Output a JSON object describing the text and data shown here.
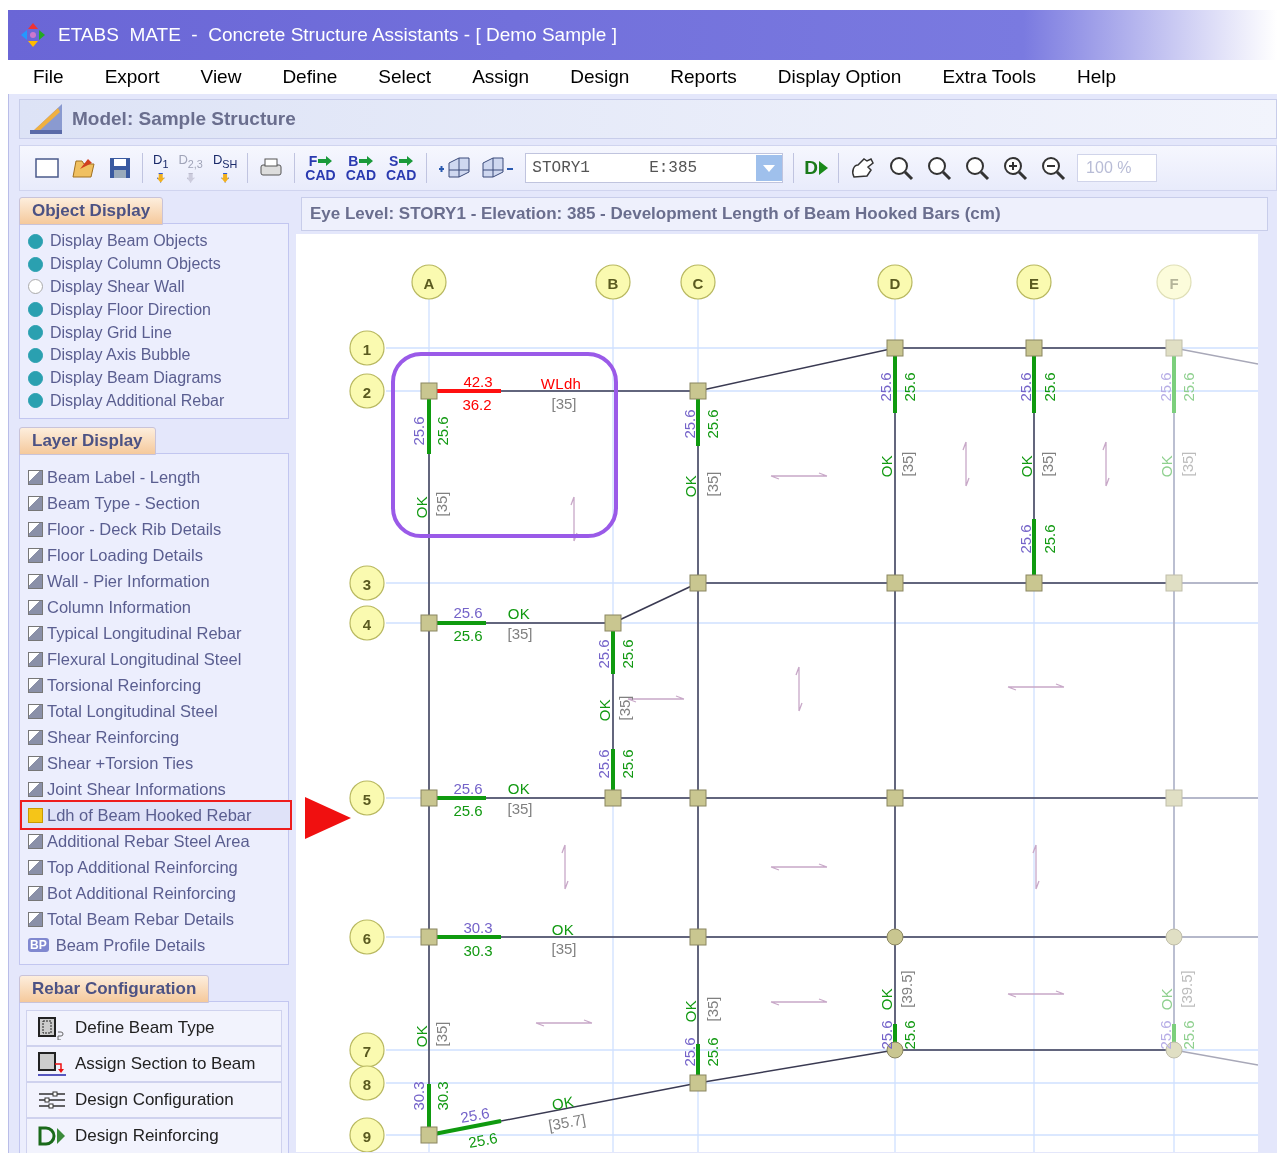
{
  "window": {
    "title": "ETABS  MATE  -  Concrete Structure Assistants - [ Demo Sample ]"
  },
  "menu": [
    "File",
    "Export",
    "View",
    "Define",
    "Select",
    "Assign",
    "Design",
    "Reports",
    "Display Option",
    "Extra Tools",
    "Help"
  ],
  "model_header": "Model: Sample Structure",
  "toolbar": {
    "design_keys": [
      {
        "label": "D$_{1}$",
        "disabled": false
      },
      {
        "label": "D$_{2,3}$",
        "disabled": true
      },
      {
        "label": "D$_{SH}$",
        "disabled": false
      }
    ],
    "cad_exports": [
      {
        "letter": "F",
        "label": "CAD"
      },
      {
        "letter": "B",
        "label": "CAD"
      },
      {
        "letter": "S",
        "label": "CAD"
      }
    ],
    "story_select": {
      "story": "STORY1",
      "elevation": "E:385"
    },
    "run_design": "D",
    "zoom_level": {
      "value": "100 %",
      "disabled": true
    }
  },
  "object_display": {
    "title": "Object Display",
    "items": [
      {
        "label": "Display Beam Objects",
        "checked": true
      },
      {
        "label": "Display Column Objects",
        "checked": true
      },
      {
        "label": "Display Shear Wall",
        "checked": false
      },
      {
        "label": "Display Floor Direction",
        "checked": true
      },
      {
        "label": "Display Grid Line",
        "checked": true
      },
      {
        "label": "Display Axis Bubble",
        "checked": true
      },
      {
        "label": "Display Beam Diagrams",
        "checked": true
      },
      {
        "label": "Display Additional Rebar",
        "checked": true
      }
    ]
  },
  "layer_display": {
    "title": "Layer Display",
    "items": [
      {
        "label": "Beam Label - Length",
        "selected": false
      },
      {
        "label": "Beam Type - Section",
        "selected": false
      },
      {
        "label": "Floor - Deck Rib Details",
        "selected": false
      },
      {
        "label": "Floor Loading Details",
        "selected": false
      },
      {
        "label": "Wall - Pier Information",
        "selected": false
      },
      {
        "label": "Column Information",
        "selected": false
      },
      {
        "label": "Typical Longitudinal Rebar",
        "selected": false
      },
      {
        "label": "Flexural Longitudinal Steel",
        "selected": false
      },
      {
        "label": "Torsional Reinforcing",
        "selected": false
      },
      {
        "label": "Total Longitudinal Steel",
        "selected": false
      },
      {
        "label": "Shear Reinforcing",
        "selected": false
      },
      {
        "label": "Shear +Torsion Ties",
        "selected": false
      },
      {
        "label": "Joint Shear Informations",
        "selected": false
      },
      {
        "label": "Ldh of Beam Hooked Rebar",
        "selected": true
      },
      {
        "label": "Additional Rebar Steel Area",
        "selected": false
      },
      {
        "label": "Top Additional Reinforcing",
        "selected": false
      },
      {
        "label": "Bot  Additional Reinforcing",
        "selected": false
      },
      {
        "label": "Total Beam Rebar Details",
        "selected": false
      }
    ],
    "profile": {
      "badge": "BP",
      "label": "Beam Profile Details"
    }
  },
  "rebar_configuration": {
    "title": "Rebar Configuration",
    "buttons": [
      {
        "kind": "define",
        "label": "Define Beam Type"
      },
      {
        "kind": "assign",
        "label": "Assign Section to Beam"
      },
      {
        "kind": "config",
        "label": "Design Configuration"
      },
      {
        "kind": "design",
        "label": "Design Reinforcing"
      }
    ]
  },
  "canvas": {
    "title": "Eye Level: STORY1 - Elevation: 385 - Development Length of Beam Hooked Bars (cm)",
    "column_axes": [
      {
        "label": "A",
        "dimmed": false
      },
      {
        "label": "B",
        "dimmed": false
      },
      {
        "label": "C",
        "dimmed": false
      },
      {
        "label": "D",
        "dimmed": false
      },
      {
        "label": "E",
        "dimmed": false
      },
      {
        "label": "F",
        "dimmed": true
      }
    ],
    "row_axes": [
      "1",
      "2",
      "3",
      "4",
      "5",
      "6",
      "7",
      "8",
      "9"
    ],
    "annotations": [
      {
        "text": "42.3",
        "kind": "value",
        "color": "#ff0000"
      },
      {
        "text": "36.2",
        "kind": "value",
        "color": "#ff0000"
      },
      {
        "text": "WLdh",
        "kind": "status",
        "color": "#ff0000"
      },
      {
        "text": "[35]",
        "kind": "limit",
        "color": "#808080"
      },
      {
        "text": "25.6",
        "kind": "value",
        "color": "#7463c9"
      },
      {
        "text": "25.6",
        "kind": "value",
        "color": "#119911"
      },
      {
        "text": "OK",
        "kind": "status",
        "color": "#119911"
      },
      {
        "text": "[35]",
        "kind": "limit",
        "color": "#808080"
      },
      {
        "text": "25.6",
        "kind": "value",
        "color": "#7463c9"
      },
      {
        "text": "25.6",
        "kind": "value",
        "color": "#119911"
      },
      {
        "text": "OK",
        "kind": "status",
        "color": "#119911"
      },
      {
        "text": "[35]",
        "kind": "limit",
        "color": "#808080"
      },
      {
        "text": "25.6",
        "kind": "value",
        "color": "#7463c9"
      },
      {
        "text": "25.6",
        "kind": "value",
        "color": "#119911"
      },
      {
        "text": "OK",
        "kind": "status",
        "color": "#119911"
      },
      {
        "text": "[35]",
        "kind": "limit",
        "color": "#808080"
      },
      {
        "text": "25.6",
        "kind": "value",
        "color": "#7463c9"
      },
      {
        "text": "25.6",
        "kind": "value",
        "color": "#119911"
      },
      {
        "text": "OK",
        "kind": "status",
        "color": "#119911"
      },
      {
        "text": "[35]",
        "kind": "limit",
        "color": "#808080"
      },
      {
        "text": "25.6",
        "kind": "value",
        "color": "#7463c9"
      },
      {
        "text": "25.6",
        "kind": "value",
        "color": "#119911"
      },
      {
        "text": "25.6",
        "kind": "value",
        "color": "#b7aee6"
      },
      {
        "text": "25.6",
        "kind": "value",
        "color": "#8fd08f"
      },
      {
        "text": "OK",
        "kind": "status",
        "color": "#8fd08f"
      },
      {
        "text": "[35]",
        "kind": "limit",
        "color": "#bcbcbc"
      },
      {
        "text": "25.6",
        "kind": "value",
        "color": "#7463c9"
      },
      {
        "text": "25.6",
        "kind": "value",
        "color": "#119911"
      },
      {
        "text": "OK",
        "kind": "status",
        "color": "#119911"
      },
      {
        "text": "[35]",
        "kind": "limit",
        "color": "#808080"
      },
      {
        "text": "25.6",
        "kind": "value",
        "color": "#7463c9"
      },
      {
        "text": "25.6",
        "kind": "value",
        "color": "#119911"
      },
      {
        "text": "OK",
        "kind": "status",
        "color": "#119911"
      },
      {
        "text": "[35]",
        "kind": "limit",
        "color": "#808080"
      },
      {
        "text": "25.6",
        "kind": "value",
        "color": "#7463c9"
      },
      {
        "text": "25.6",
        "kind": "value",
        "color": "#119911"
      },
      {
        "text": "25.6",
        "kind": "value",
        "color": "#7463c9"
      },
      {
        "text": "25.6",
        "kind": "value",
        "color": "#119911"
      },
      {
        "text": "OK",
        "kind": "status",
        "color": "#119911"
      },
      {
        "text": "[35]",
        "kind": "limit",
        "color": "#808080"
      },
      {
        "text": "30.3",
        "kind": "value",
        "color": "#7463c9"
      },
      {
        "text": "30.3",
        "kind": "value",
        "color": "#119911"
      },
      {
        "text": "OK",
        "kind": "status",
        "color": "#119911"
      },
      {
        "text": "[35]",
        "kind": "limit",
        "color": "#808080"
      },
      {
        "text": "OK",
        "kind": "status",
        "color": "#119911"
      },
      {
        "text": "[35]",
        "kind": "limit",
        "color": "#808080"
      },
      {
        "text": "OK",
        "kind": "status",
        "color": "#119911"
      },
      {
        "text": "[35]",
        "kind": "limit",
        "color": "#808080"
      },
      {
        "text": "25.6",
        "kind": "value",
        "color": "#7463c9"
      },
      {
        "text": "25.6",
        "kind": "value",
        "color": "#119911"
      },
      {
        "text": "25.6",
        "kind": "value",
        "color": "#7463c9"
      },
      {
        "text": "OK",
        "kind": "status",
        "color": "#119911"
      },
      {
        "text": "[39.5]",
        "kind": "limit",
        "color": "#808080"
      },
      {
        "text": "25.6",
        "kind": "value",
        "color": "#119911"
      },
      {
        "text": "25.6",
        "kind": "value",
        "color": "#b7aee6"
      },
      {
        "text": "OK",
        "kind": "status",
        "color": "#8fd08f"
      },
      {
        "text": "[39.5]",
        "kind": "limit",
        "color": "#bcbcbc"
      },
      {
        "text": "25.6",
        "kind": "value",
        "color": "#8fd08f"
      },
      {
        "text": "30.3",
        "kind": "value",
        "color": "#7463c9"
      },
      {
        "text": "30.3",
        "kind": "value",
        "color": "#119911"
      },
      {
        "text": "25.6",
        "kind": "value",
        "color": "#7463c9"
      },
      {
        "text": "25.6",
        "kind": "value",
        "color": "#119911"
      },
      {
        "text": "OK",
        "kind": "status",
        "color": "#119911"
      },
      {
        "text": "[35.7]",
        "kind": "limit",
        "color": "#808080"
      }
    ]
  }
}
